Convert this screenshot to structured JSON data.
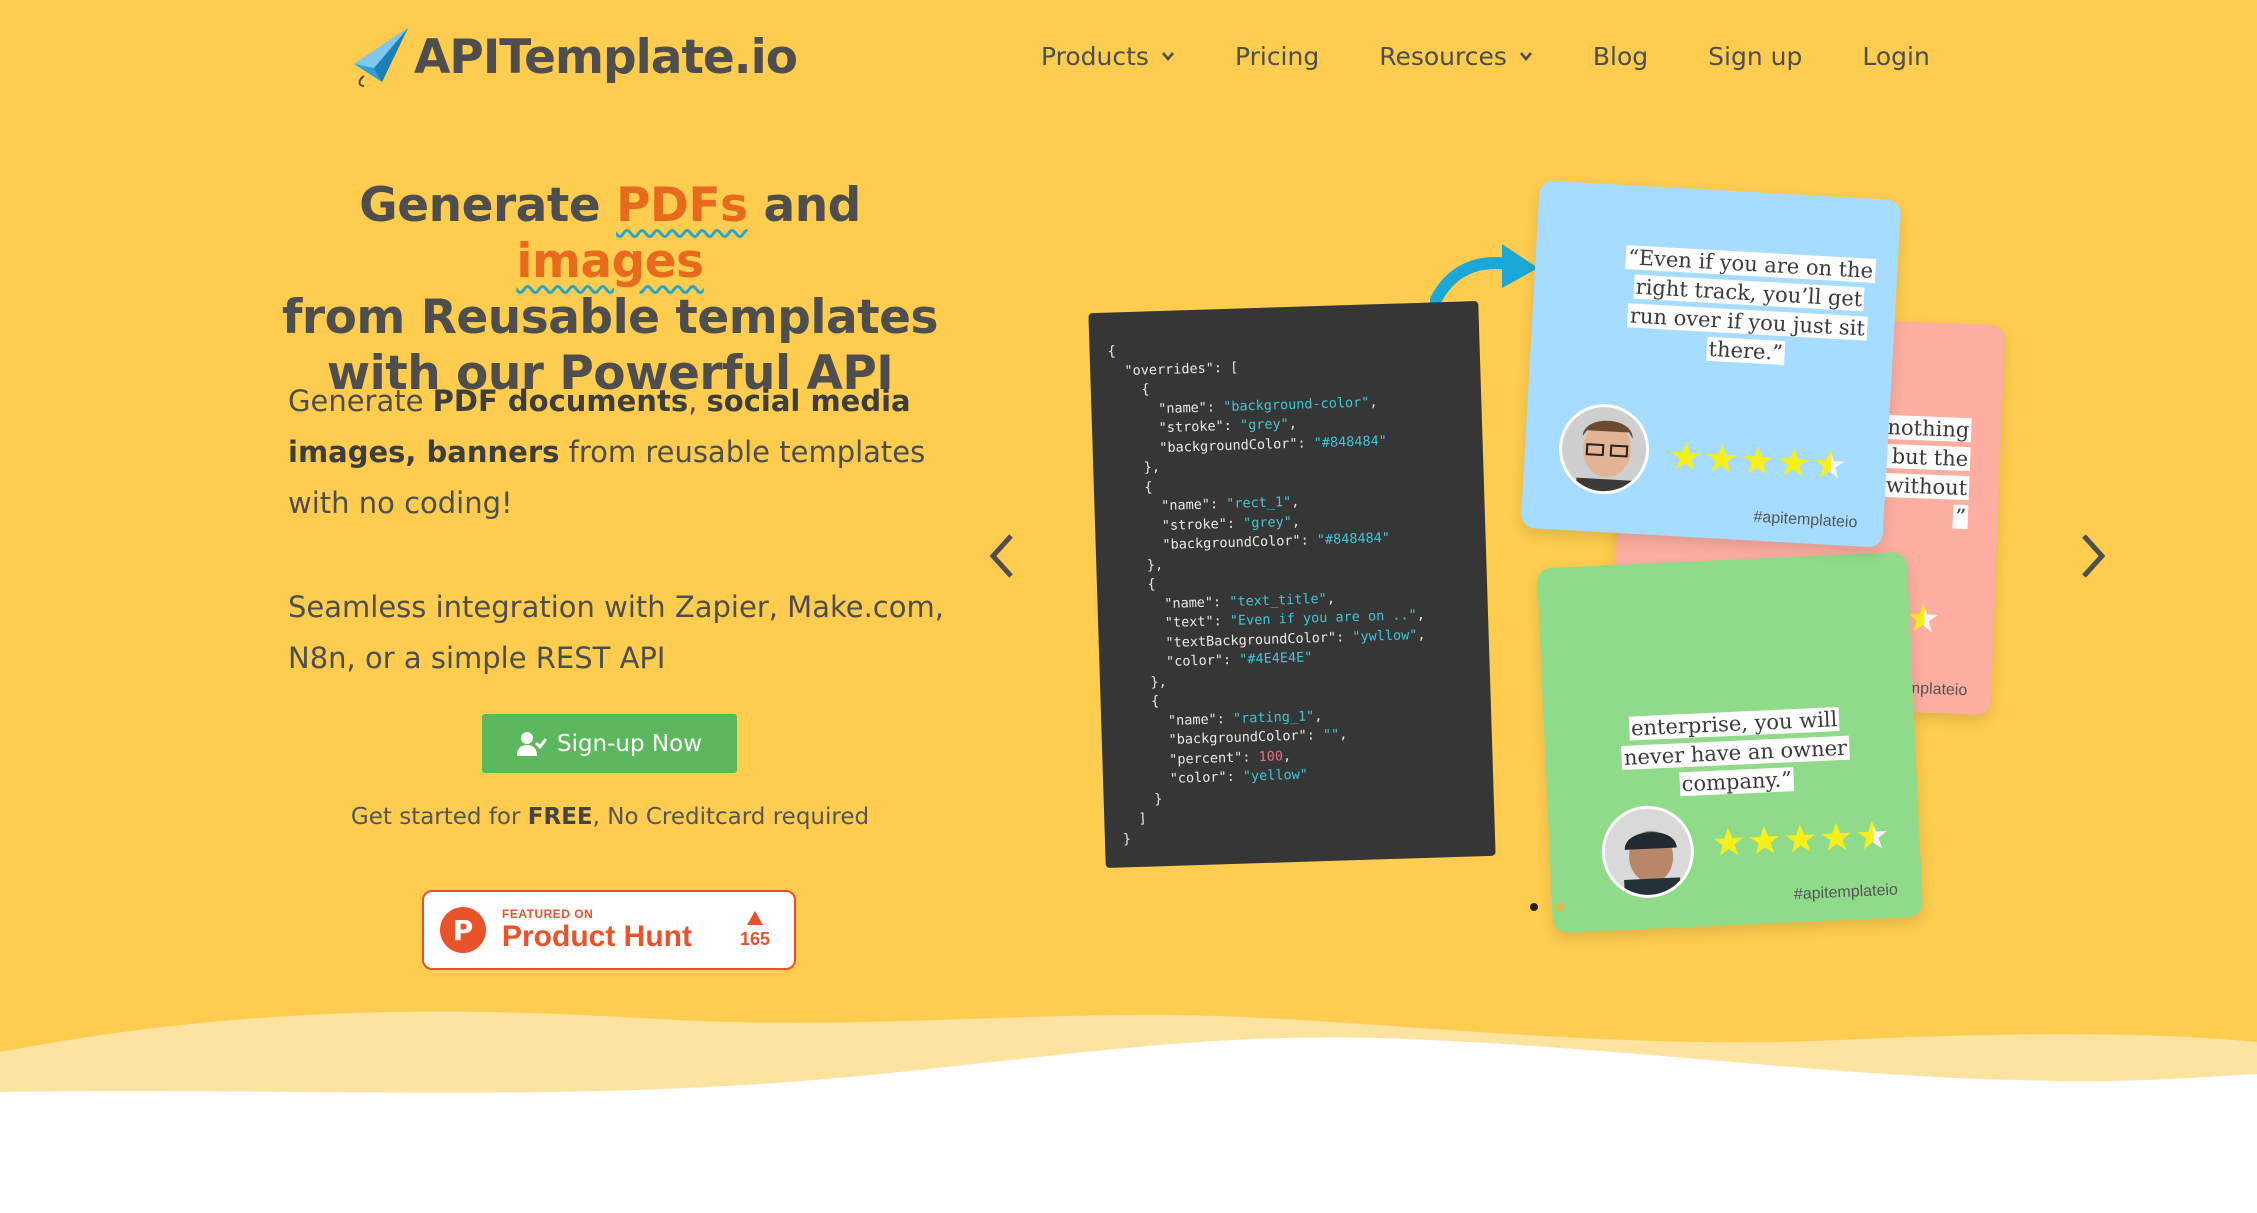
{
  "header": {
    "logo_text": "APITemplate.io",
    "nav": {
      "products": "Products",
      "pricing": "Pricing",
      "resources": "Resources",
      "blog": "Blog",
      "signup": "Sign up",
      "login": "Login"
    }
  },
  "hero": {
    "headline_1": "Generate ",
    "headline_pdfs": "PDFs",
    "headline_and": " and ",
    "headline_images": "images",
    "headline_2": "from Reusable templates",
    "headline_3": "with our Powerful API",
    "desc_prefix": "Generate ",
    "desc_bold1": "PDF documents",
    "desc_comma": ", ",
    "desc_bold2": "social media images, banners",
    "desc_suffix": " from reusable templates with no coding!",
    "integration": "Seamless integration with Zapier, Make.com, N8n, or a simple REST API",
    "signup_button": "Sign-up Now",
    "note_prefix": "Get started for ",
    "note_bold": "FREE",
    "note_suffix": ", No Creditcard required",
    "product_hunt": {
      "featured": "FEATURED ON",
      "name": "Product Hunt",
      "votes": "165"
    }
  },
  "carousel": {
    "code_lines": [
      [
        "{",
        ""
      ],
      [
        "  \"overrides\": [",
        ""
      ],
      [
        "    {",
        ""
      ],
      [
        "      \"name\": ",
        "\"background-color\"",
        ","
      ],
      [
        "      \"stroke\": ",
        "\"grey\"",
        ","
      ],
      [
        "      \"backgroundColor\": ",
        "\"#848484\"",
        ""
      ],
      [
        "    },",
        ""
      ],
      [
        "    {",
        ""
      ],
      [
        "      \"name\": ",
        "\"rect_1\"",
        ","
      ],
      [
        "      \"stroke\": ",
        "\"grey\"",
        ","
      ],
      [
        "      \"backgroundColor\": ",
        "\"#848484\"",
        ""
      ],
      [
        "    },",
        ""
      ],
      [
        "    {",
        ""
      ],
      [
        "      \"name\": ",
        "\"text_title\"",
        ","
      ],
      [
        "      \"text\": ",
        "\"Even if you are on ..\"",
        ","
      ],
      [
        "      \"textBackgroundColor\": ",
        "\"ywllow\"",
        ","
      ],
      [
        "      \"color\": ",
        "\"#4E4E4E\"",
        ""
      ],
      [
        "    },",
        ""
      ],
      [
        "    {",
        ""
      ],
      [
        "      \"name\": ",
        "\"rating_1\"",
        ","
      ],
      [
        "      \"backgroundColor\": ",
        "\"\"",
        ","
      ],
      [
        "      \"percent\": ",
        "#100",
        ","
      ],
      [
        "      \"color\": ",
        "\"yellow\"",
        ""
      ],
      [
        "    }",
        ""
      ],
      [
        "  ]",
        ""
      ],
      [
        "}",
        ""
      ]
    ],
    "card_blue_quote": "“Even if you are on the right track, you’ll get run over if you just sit there.”",
    "card_pink_quote": "nothing ft, but the g without",
    "card_pink_quote_lines": [
      "nothing",
      "ft, but the",
      "g without",
      "”"
    ],
    "card_green_quote_lines": [
      "enterprise, you will",
      "never have an owner",
      "company.”"
    ],
    "hashtag": "#apitemplateio"
  },
  "colors": {
    "background": "#fecd4f",
    "text": "#4e4e4e",
    "accent": "#e86a1c",
    "underline": "#2aa6c7",
    "button": "#5cb85c",
    "product_hunt": "#ea532a",
    "card_blue": "#a6dcff",
    "card_pink": "#fcaea0",
    "card_green": "#8fdb8a"
  }
}
